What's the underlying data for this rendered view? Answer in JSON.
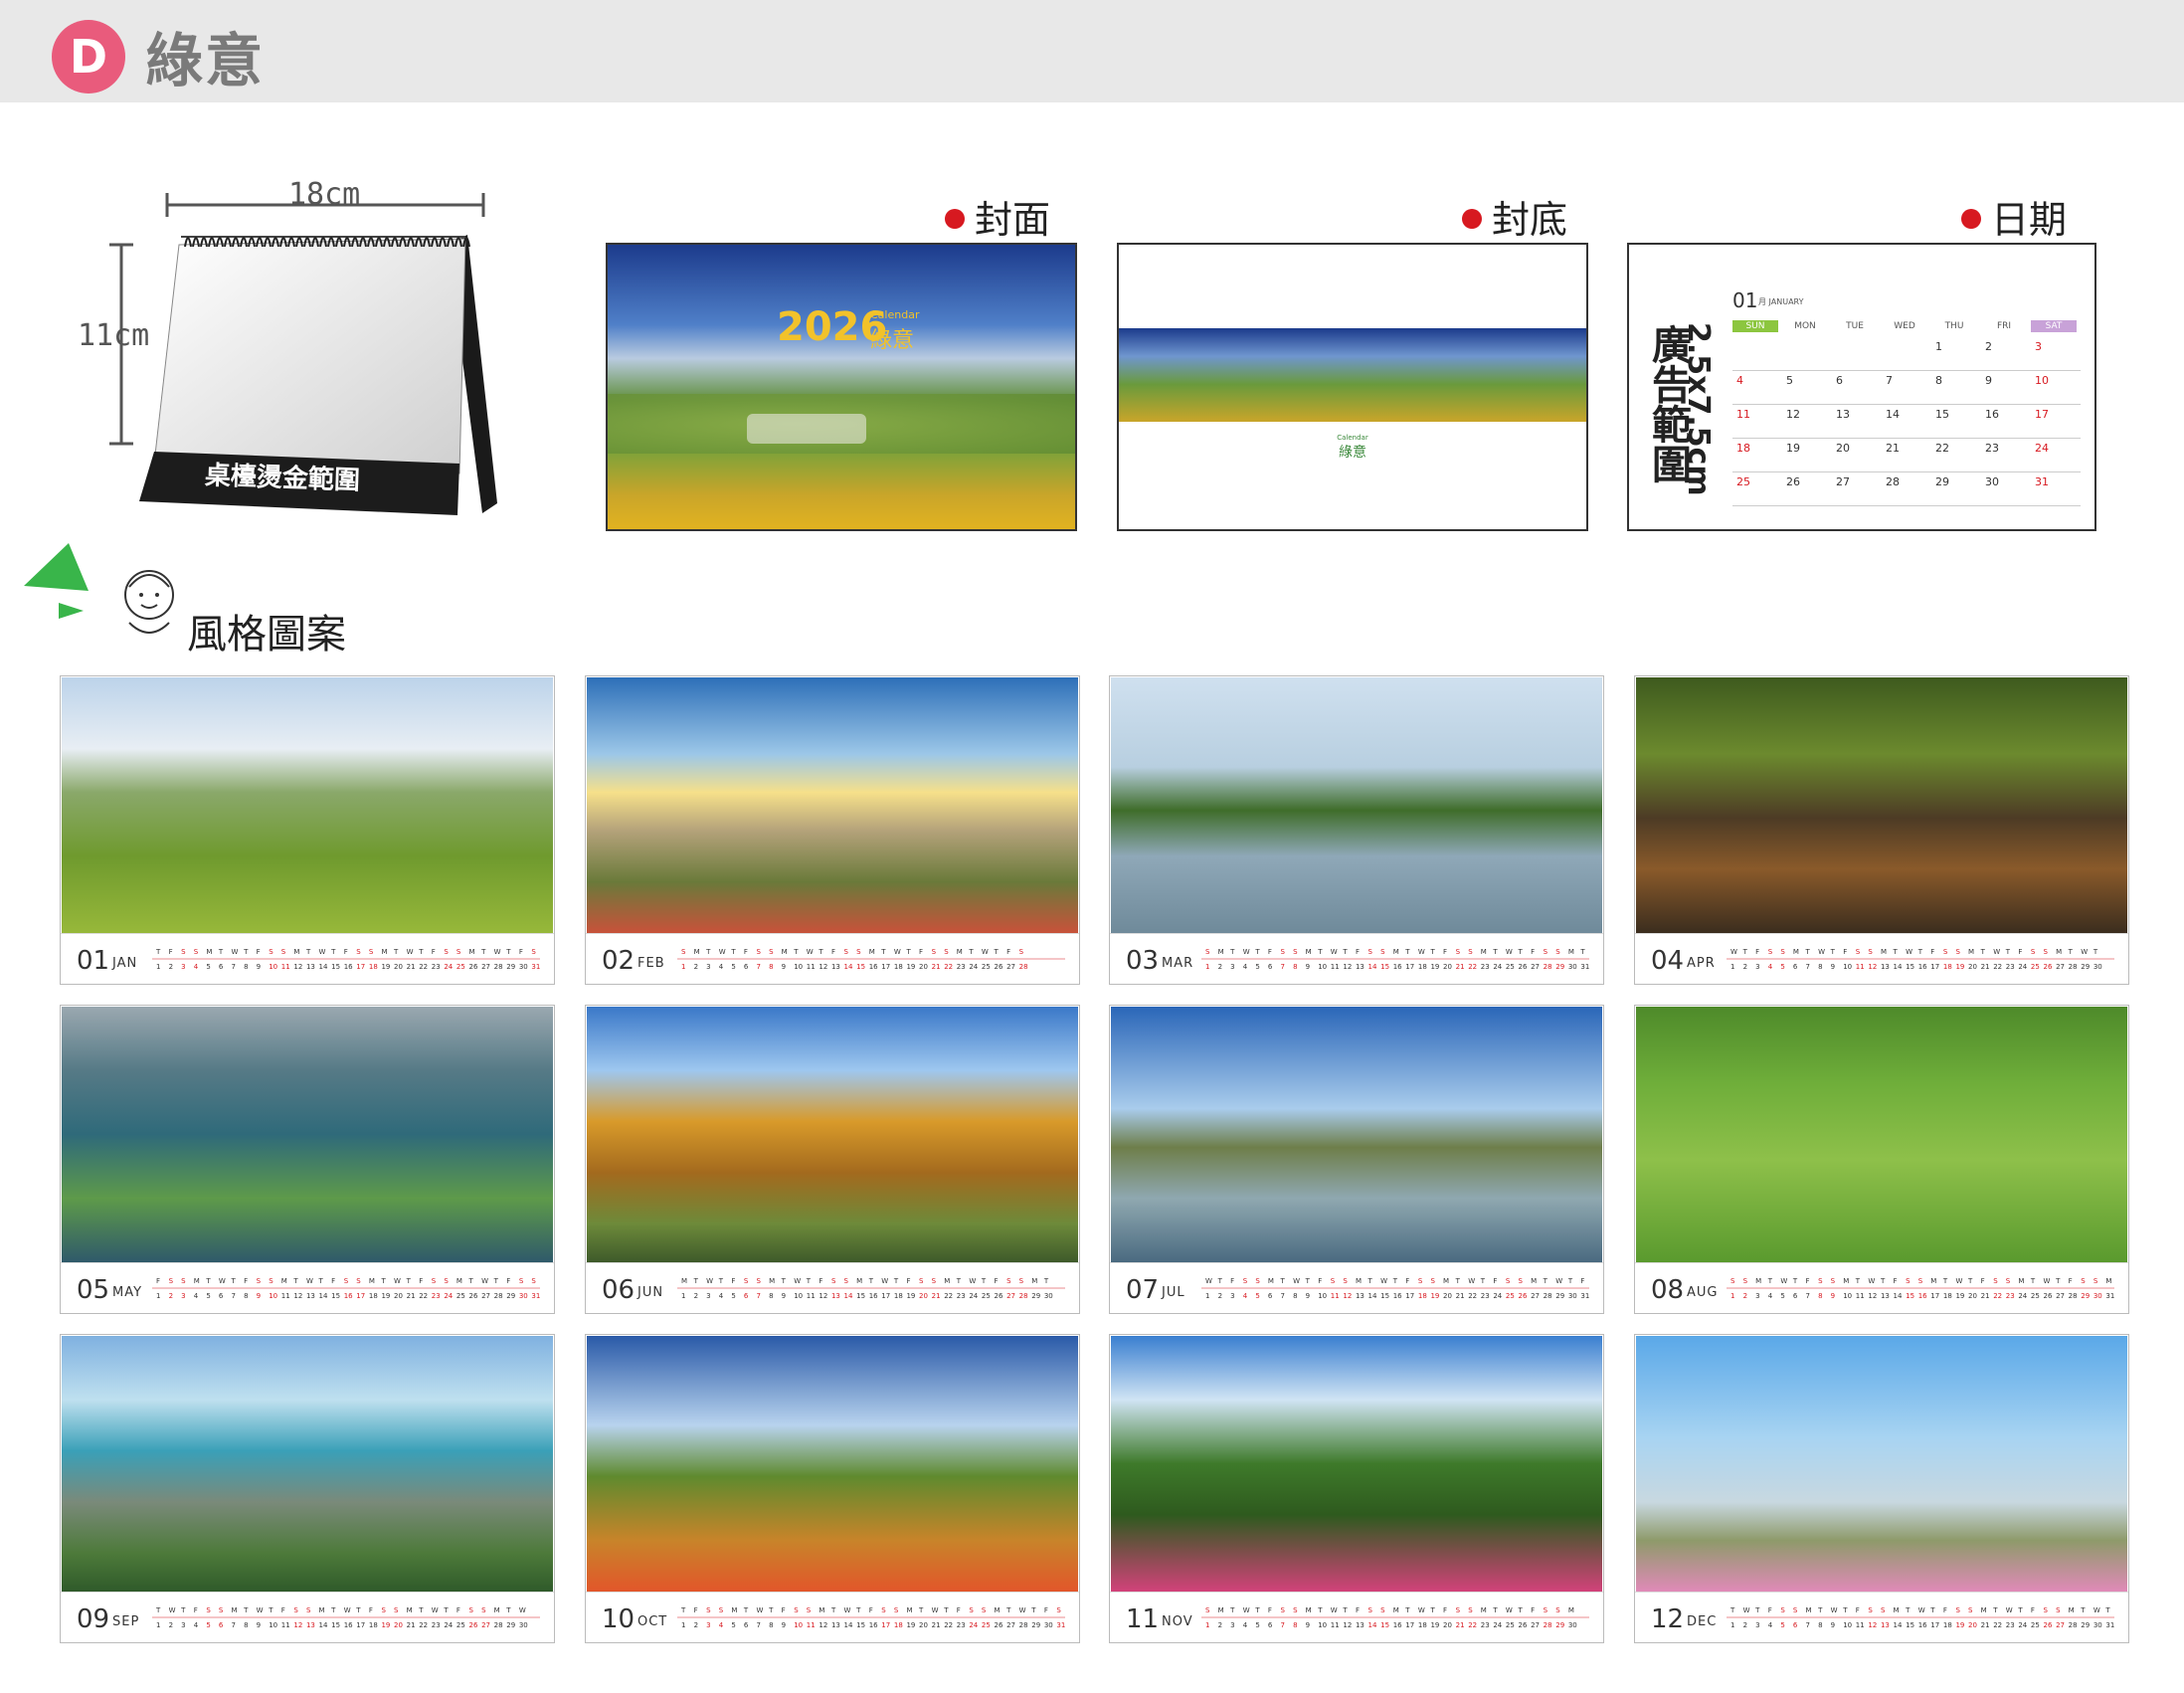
{
  "header": {
    "badge": "D",
    "brand": "綠意"
  },
  "diagram": {
    "width_label": "18cm",
    "height_label": "11cm",
    "imprint_label": "桌檯燙金範圍"
  },
  "sections": {
    "cover": "封面",
    "back": "封底",
    "dates": "日期"
  },
  "cover": {
    "year": "2026",
    "calendar_word": "Calendar",
    "brand": "綠意"
  },
  "back": {
    "calendar_word": "Calendar",
    "brand": "綠意"
  },
  "dates_panel": {
    "ad_text": "廣告範圍",
    "ad_size": "2.5x7.5cm",
    "month_num": "01",
    "month_name": "月 JANUARY",
    "weekdays": [
      "SUN",
      "MON",
      "TUE",
      "WED",
      "THU",
      "FRI",
      "SAT"
    ],
    "rows": [
      [
        "",
        "",
        "",
        "",
        "1",
        "2",
        "3"
      ],
      [
        "4",
        "5",
        "6",
        "7",
        "8",
        "9",
        "10"
      ],
      [
        "11",
        "12",
        "13",
        "14",
        "15",
        "16",
        "17"
      ],
      [
        "18",
        "19",
        "20",
        "21",
        "22",
        "23",
        "24"
      ],
      [
        "25",
        "26",
        "27",
        "28",
        "29",
        "30",
        "31"
      ]
    ]
  },
  "style_title": "風格圖案",
  "months": [
    {
      "num": "01",
      "name": "JAN",
      "days": 31
    },
    {
      "num": "02",
      "name": "FEB",
      "days": 28
    },
    {
      "num": "03",
      "name": "MAR",
      "days": 31
    },
    {
      "num": "04",
      "name": "APR",
      "days": 30
    },
    {
      "num": "05",
      "name": "MAY",
      "days": 31
    },
    {
      "num": "06",
      "name": "JUN",
      "days": 30
    },
    {
      "num": "07",
      "name": "JUL",
      "days": 31
    },
    {
      "num": "08",
      "name": "AUG",
      "days": 31
    },
    {
      "num": "09",
      "name": "SEP",
      "days": 30
    },
    {
      "num": "10",
      "name": "OCT",
      "days": 31
    },
    {
      "num": "11",
      "name": "NOV",
      "days": 30
    },
    {
      "num": "12",
      "name": "DEC",
      "days": 31
    }
  ],
  "colors": {
    "badge": "#e95b7c",
    "dot": "#d71920",
    "sat_red": "#d71920",
    "sun_green": "#8cc63f",
    "sat_purple": "#c8a2d8"
  }
}
